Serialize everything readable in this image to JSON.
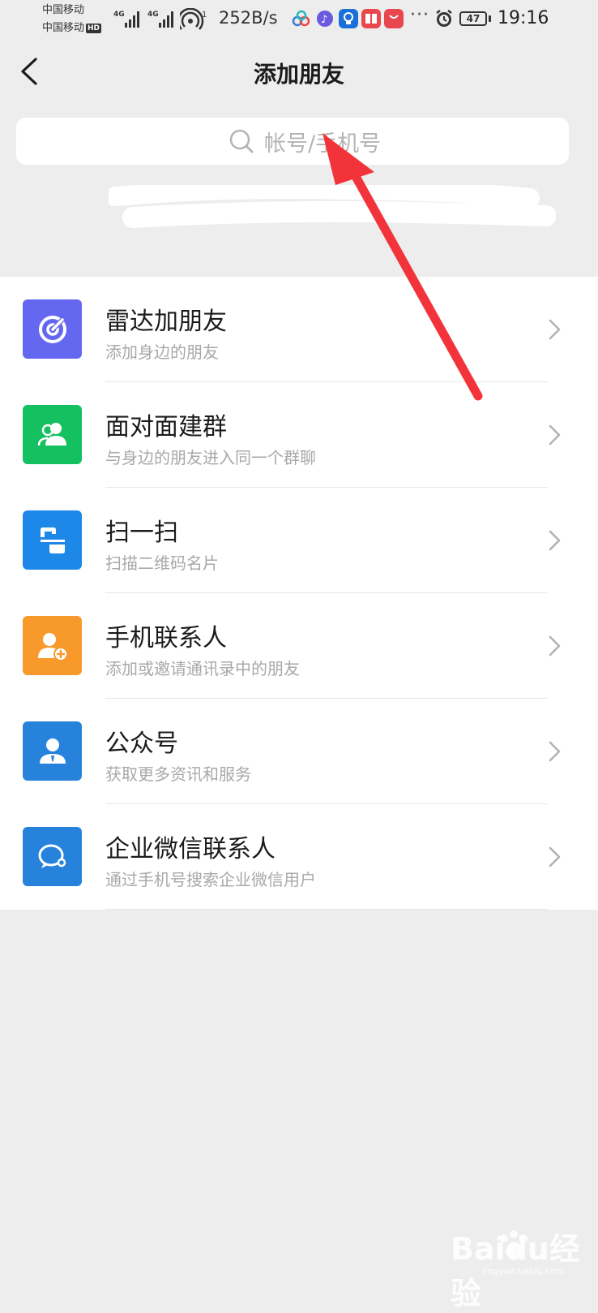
{
  "status_bar": {
    "carrier_1": "中国移动",
    "carrier_2": "中国移动",
    "hd_label": "HD",
    "net_type_1": "4G",
    "net_type_2": "4G",
    "hotspot_count": "1",
    "speed": "252B/s",
    "battery": "47",
    "time": "19:16",
    "more": "···"
  },
  "header": {
    "title": "添加朋友"
  },
  "search": {
    "placeholder": "帐号/手机号"
  },
  "menu": [
    {
      "title": "雷达加朋友",
      "subtitle": "添加身边的朋友",
      "icon": "radar-icon",
      "color": "#6467ef"
    },
    {
      "title": "面对面建群",
      "subtitle": "与身边的朋友进入同一个群聊",
      "icon": "face-to-face-group-icon",
      "color": "#14c060"
    },
    {
      "title": "扫一扫",
      "subtitle": "扫描二维码名片",
      "icon": "scan-icon",
      "color": "#1e88e9"
    },
    {
      "title": "手机联系人",
      "subtitle": "添加或邀请通讯录中的朋友",
      "icon": "phone-contacts-icon",
      "color": "#f79a2b"
    },
    {
      "title": "公众号",
      "subtitle": "获取更多资讯和服务",
      "icon": "official-account-icon",
      "color": "#2782db"
    },
    {
      "title": "企业微信联系人",
      "subtitle": "通过手机号搜索企业微信用户",
      "icon": "wecom-contacts-icon",
      "color": "#2782db"
    }
  ],
  "watermark": {
    "text": "Baidu经验",
    "sub": "jingyan.baidu.com"
  },
  "colors": {
    "background": "#ededed",
    "annotation_arrow": "#f2343a"
  }
}
